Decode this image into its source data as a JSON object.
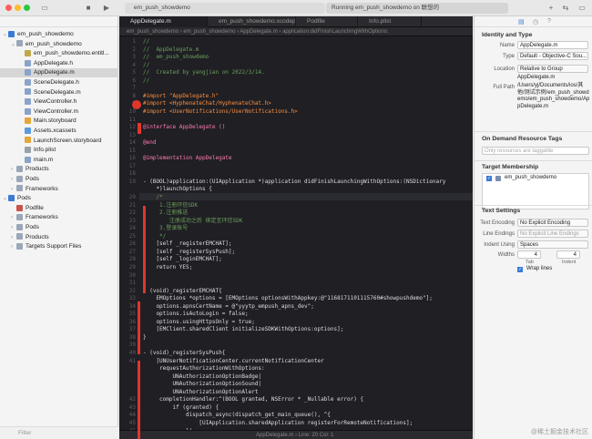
{
  "titlebar": {
    "scheme_label": "em_push_showdemo",
    "status_label": "Running em_push_showdemo on 联想的"
  },
  "navigator": {
    "filter_placeholder": "Filter",
    "items": [
      {
        "label": "em_push_showdemo",
        "icon": "project-icon",
        "indent": 0,
        "disclosure": "open",
        "color": "#3b7bd6"
      },
      {
        "label": "em_push_showdemo",
        "icon": "folder-icon",
        "indent": 1,
        "disclosure": "open",
        "color": "#9aa7b8"
      },
      {
        "label": "em_push_showdemo.entitl...",
        "icon": "file-icon",
        "indent": 2,
        "disclosure": "",
        "color": "#c0a84a"
      },
      {
        "label": "AppDelegate.h",
        "icon": "header-file-icon",
        "indent": 2,
        "disclosure": "",
        "color": "#8aa3c9"
      },
      {
        "label": "AppDelegate.m",
        "icon": "source-file-icon",
        "indent": 2,
        "disclosure": "",
        "color": "#8aa3c9",
        "selected": true
      },
      {
        "label": "SceneDelegate.h",
        "icon": "header-file-icon",
        "indent": 2,
        "disclosure": "",
        "color": "#8aa3c9"
      },
      {
        "label": "SceneDelegate.m",
        "icon": "source-file-icon",
        "indent": 2,
        "disclosure": "",
        "color": "#8aa3c9"
      },
      {
        "label": "ViewController.h",
        "icon": "header-file-icon",
        "indent": 2,
        "disclosure": "",
        "color": "#8aa3c9"
      },
      {
        "label": "ViewController.m",
        "icon": "source-file-icon",
        "indent": 2,
        "disclosure": "",
        "color": "#8aa3c9"
      },
      {
        "label": "Main.storyboard",
        "icon": "storyboard-icon",
        "indent": 2,
        "disclosure": "",
        "color": "#e3a63a"
      },
      {
        "label": "Assets.xcassets",
        "icon": "assets-icon",
        "indent": 2,
        "disclosure": "",
        "color": "#5a9be0"
      },
      {
        "label": "LaunchScreen.storyboard",
        "icon": "storyboard-icon",
        "indent": 2,
        "disclosure": "",
        "color": "#e3a63a"
      },
      {
        "label": "Info.plist",
        "icon": "plist-icon",
        "indent": 2,
        "disclosure": "",
        "color": "#9aa0a8"
      },
      {
        "label": "main.m",
        "icon": "source-file-icon",
        "indent": 2,
        "disclosure": "",
        "color": "#8aa3c9"
      },
      {
        "label": "Products",
        "icon": "folder-icon",
        "indent": 1,
        "disclosure": "closed",
        "color": "#9aa7b8"
      },
      {
        "label": "Pods",
        "icon": "folder-icon",
        "indent": 1,
        "disclosure": "closed",
        "color": "#9aa7b8"
      },
      {
        "label": "Frameworks",
        "icon": "folder-icon",
        "indent": 1,
        "disclosure": "closed",
        "color": "#9aa7b8"
      },
      {
        "label": "Pods",
        "icon": "project-icon",
        "indent": 0,
        "disclosure": "open",
        "color": "#3b7bd6"
      },
      {
        "label": "Podfile",
        "icon": "file-icon",
        "indent": 1,
        "disclosure": "",
        "color": "#c9524a"
      },
      {
        "label": "Frameworks",
        "icon": "folder-icon",
        "indent": 1,
        "disclosure": "closed",
        "color": "#9aa7b8"
      },
      {
        "label": "Pods",
        "icon": "folder-icon",
        "indent": 1,
        "disclosure": "closed",
        "color": "#9aa7b8"
      },
      {
        "label": "Products",
        "icon": "folder-icon",
        "indent": 1,
        "disclosure": "closed",
        "color": "#9aa7b8"
      },
      {
        "label": "Targets Support Files",
        "icon": "folder-icon",
        "indent": 1,
        "disclosure": "closed",
        "color": "#9aa7b8"
      }
    ]
  },
  "editor": {
    "tabs": [
      {
        "label": "AppDelegate.m",
        "active": true
      },
      {
        "label": "em_push_showdemo.xcodeproj",
        "active": false
      },
      {
        "label": "Podfile",
        "active": false
      },
      {
        "label": "Info.plist",
        "active": false
      }
    ],
    "jumpbar": "em_push_showdemo  ›  em_push_showdemo  ›  AppDelegate.m  ›  application:didFinishLaunchingWithOptions:",
    "bottom_bar": "AppDelegate.m  ›  Line: 20  Col: 1",
    "lines": [
      {
        "n": "1",
        "t": "//",
        "c": "comment"
      },
      {
        "n": "2",
        "t": "//  AppDelegate.m",
        "c": "comment"
      },
      {
        "n": "3",
        "t": "//  em_push_showdemo",
        "c": "comment"
      },
      {
        "n": "4",
        "t": "//",
        "c": "comment"
      },
      {
        "n": "5",
        "t": "//  Created by yangjian on 2022/3/14.",
        "c": "comment"
      },
      {
        "n": "6",
        "t": "//",
        "c": "comment"
      },
      {
        "n": "7",
        "t": "",
        "c": "plain"
      },
      {
        "n": "8",
        "t": "#import \"AppDelegate.h\"",
        "c": "pre"
      },
      {
        "n": "9",
        "t": "#import <HyphenateChat/HyphenateChat.h>",
        "c": "pre"
      },
      {
        "n": "10",
        "t": "#import <UserNotifications/UserNotifications.h>",
        "c": "pre"
      },
      {
        "n": "11",
        "t": "",
        "c": "plain"
      },
      {
        "n": "12",
        "t": "@interface AppDelegate ()",
        "c": "kw"
      },
      {
        "n": "13",
        "t": "",
        "c": "plain"
      },
      {
        "n": "14",
        "t": "@end",
        "c": "kw"
      },
      {
        "n": "15",
        "t": "",
        "c": "plain"
      },
      {
        "n": "16",
        "t": "@implementation AppDelegate",
        "c": "kw"
      },
      {
        "n": "17",
        "t": "",
        "c": "plain"
      },
      {
        "n": "18",
        "t": "",
        "c": "plain"
      },
      {
        "n": "19",
        "t": "- (BOOL)application:(UIApplication *)application didFinishLaunchingWithOptions:(NSDictionary",
        "c": "plain"
      },
      {
        "n": "",
        "t": "    *)launchOptions {",
        "c": "plain"
      },
      {
        "n": "20",
        "t": "    /*",
        "c": "comment"
      },
      {
        "n": "21",
        "t": "     1.注册环信SDK",
        "c": "comment"
      },
      {
        "n": "22",
        "t": "     2.注册推送",
        "c": "comment"
      },
      {
        "n": "23",
        "t": "        注册成功之后 绑定至环信SDK",
        "c": "comment"
      },
      {
        "n": "24",
        "t": "     3.登录账号",
        "c": "comment"
      },
      {
        "n": "25",
        "t": "     */",
        "c": "comment"
      },
      {
        "n": "26",
        "t": "    [self _registerEMCHAT];",
        "c": "plain"
      },
      {
        "n": "27",
        "t": "    [self _registerSysPush];",
        "c": "plain"
      },
      {
        "n": "28",
        "t": "    [self _loginEMCHAT];",
        "c": "plain"
      },
      {
        "n": "29",
        "t": "    return YES;",
        "c": "plain"
      },
      {
        "n": "30",
        "t": "}",
        "c": "plain"
      },
      {
        "n": "31",
        "t": "",
        "c": "plain"
      },
      {
        "n": "32",
        "t": "- (void)_registerEMCHAT{",
        "c": "plain"
      },
      {
        "n": "33",
        "t": "    EMOptions *options = [EMOptions optionsWithAppkey:@\"1168171101115760#showpushdemo\"];",
        "c": "plain"
      },
      {
        "n": "34",
        "t": "    options.apnsCertName = @\"yyytp_empush_apns_dev\";",
        "c": "plain"
      },
      {
        "n": "35",
        "t": "    options.isAutoLogin = false;",
        "c": "plain"
      },
      {
        "n": "36",
        "t": "    options.usingHttpsOnly = true;",
        "c": "plain"
      },
      {
        "n": "37",
        "t": "    [EMClient.sharedClient initializeSDKWithOptions:options];",
        "c": "plain"
      },
      {
        "n": "38",
        "t": "}",
        "c": "plain"
      },
      {
        "n": "39",
        "t": "",
        "c": "plain"
      },
      {
        "n": "40",
        "t": "- (void)_registerSysPush{",
        "c": "plain"
      },
      {
        "n": "41",
        "t": "    [UNUserNotificationCenter.currentNotificationCenter",
        "c": "plain"
      },
      {
        "n": "",
        "t": "     requestAuthorizationWithOptions:",
        "c": "plain"
      },
      {
        "n": "",
        "t": "         UNAuthorizationOptionBadge|",
        "c": "plain"
      },
      {
        "n": "",
        "t": "         UNAuthorizationOptionSound|",
        "c": "plain"
      },
      {
        "n": "",
        "t": "         UNAuthorizationOptionAlert",
        "c": "plain"
      },
      {
        "n": "42",
        "t": "     completionHandler:^(BOOL granted, NSError * _Nullable error) {",
        "c": "plain"
      },
      {
        "n": "43",
        "t": "         if (granted) {",
        "c": "plain"
      },
      {
        "n": "44",
        "t": "             dispatch_async(dispatch_get_main_queue(), ^{",
        "c": "plain"
      },
      {
        "n": "45",
        "t": "                 [UIApplication.sharedApplication registerForRemoteNotifications];",
        "c": "plain"
      },
      {
        "n": "46",
        "t": "             });",
        "c": "plain"
      },
      {
        "n": "47",
        "t": "         }",
        "c": "plain"
      }
    ]
  },
  "inspector": {
    "identity_header": "Identity and Type",
    "name_label": "Name",
    "name_value": "AppDelegate.m",
    "type_label": "Type",
    "type_value": "Default - Objective-C Sou...",
    "location_label": "Location",
    "location_value": "Relative to Group",
    "location_file": "AppDelegate.m",
    "fullpath_label": "Full Path",
    "fullpath_value": "/Users/yj/Documents/ios/其他/测试示例/em_push_showdemo/em_push_showdemo/AppDelegate.m",
    "odr_header": "On Demand Resource Tags",
    "odr_placeholder": "Only resources are taggable",
    "target_header": "Target Membership",
    "target_name": "em_push_showdemo",
    "text_header": "Text Settings",
    "encoding_label": "Text Encoding",
    "encoding_value": "No Explicit Encoding",
    "lineend_label": "Line Endings",
    "lineend_value": "No Explicit Line Endings",
    "indent_label": "Indent Using",
    "indent_value": "Spaces",
    "widths_label": "Widths",
    "tab_width": "4",
    "indent_width": "4",
    "tab_caption": "Tab",
    "indent_caption": "Indent",
    "wrap_label": "Wrap lines"
  },
  "watermark": "@稀土掘金技术社区"
}
